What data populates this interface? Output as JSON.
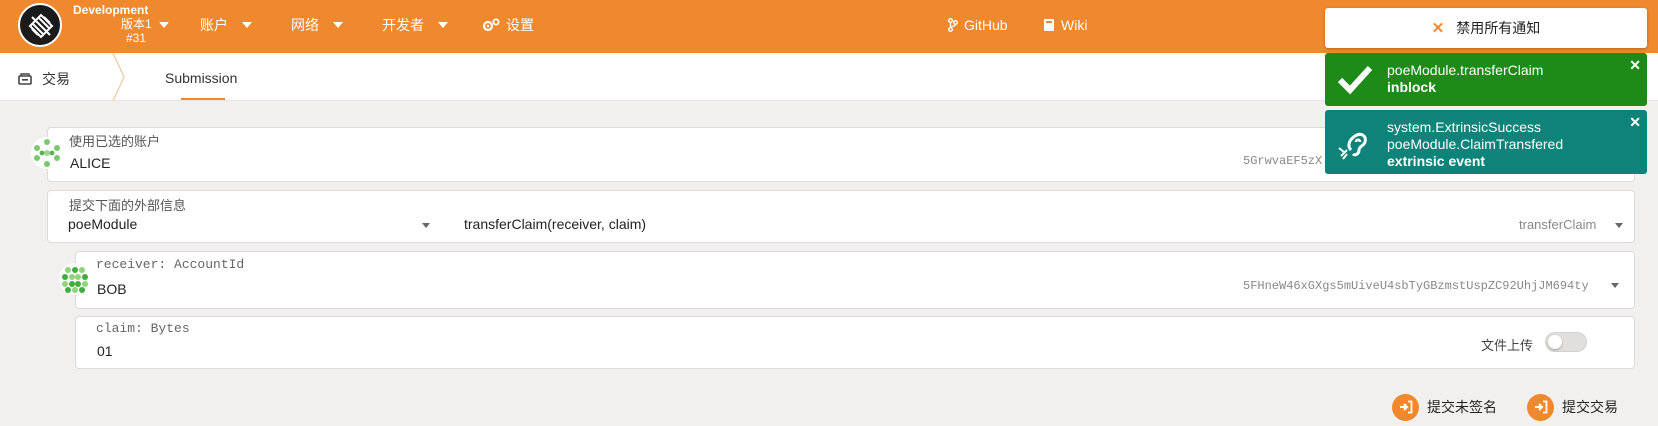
{
  "chain": {
    "name": "Development",
    "version": "版本1",
    "build": "#31"
  },
  "nav": {
    "accounts": "账户",
    "network": "网络",
    "developer": "开发者",
    "settings": "设置",
    "github": "GitHub",
    "wiki": "Wiki"
  },
  "toasts": {
    "disable_all": "禁用所有通知",
    "inblock": {
      "title": "poeModule.transferClaim",
      "status": "inblock"
    },
    "event": {
      "line1": "system.ExtrinsicSuccess",
      "line2": "poeModule.ClaimTransfered",
      "status": "extrinsic event"
    }
  },
  "breadcrumb": {
    "section": "交易",
    "tab": "Submission"
  },
  "account_field": {
    "label": "使用已选的账户",
    "value": "ALICE",
    "address": "5GrwvaEF5zX"
  },
  "extrinsic_field": {
    "label": "提交下面的外部信息",
    "module": "poeModule",
    "method": "transferClaim(receiver, claim)",
    "method_short": "transferClaim"
  },
  "receiver_field": {
    "label": "receiver: AccountId",
    "value": "BOB",
    "address": "5FHneW46xGXgs5mUiveU4sbTyGBzmstUspZC92UhjJM694ty"
  },
  "claim_field": {
    "label": "claim: Bytes",
    "value": "01",
    "file_upload_label": "文件上传",
    "file_upload_on": false
  },
  "actions": {
    "submit_unsigned": "提交未签名",
    "submit": "提交交易"
  },
  "colors": {
    "brand": "#f0892e",
    "success": "#1e8a17",
    "event": "#0e8379"
  }
}
